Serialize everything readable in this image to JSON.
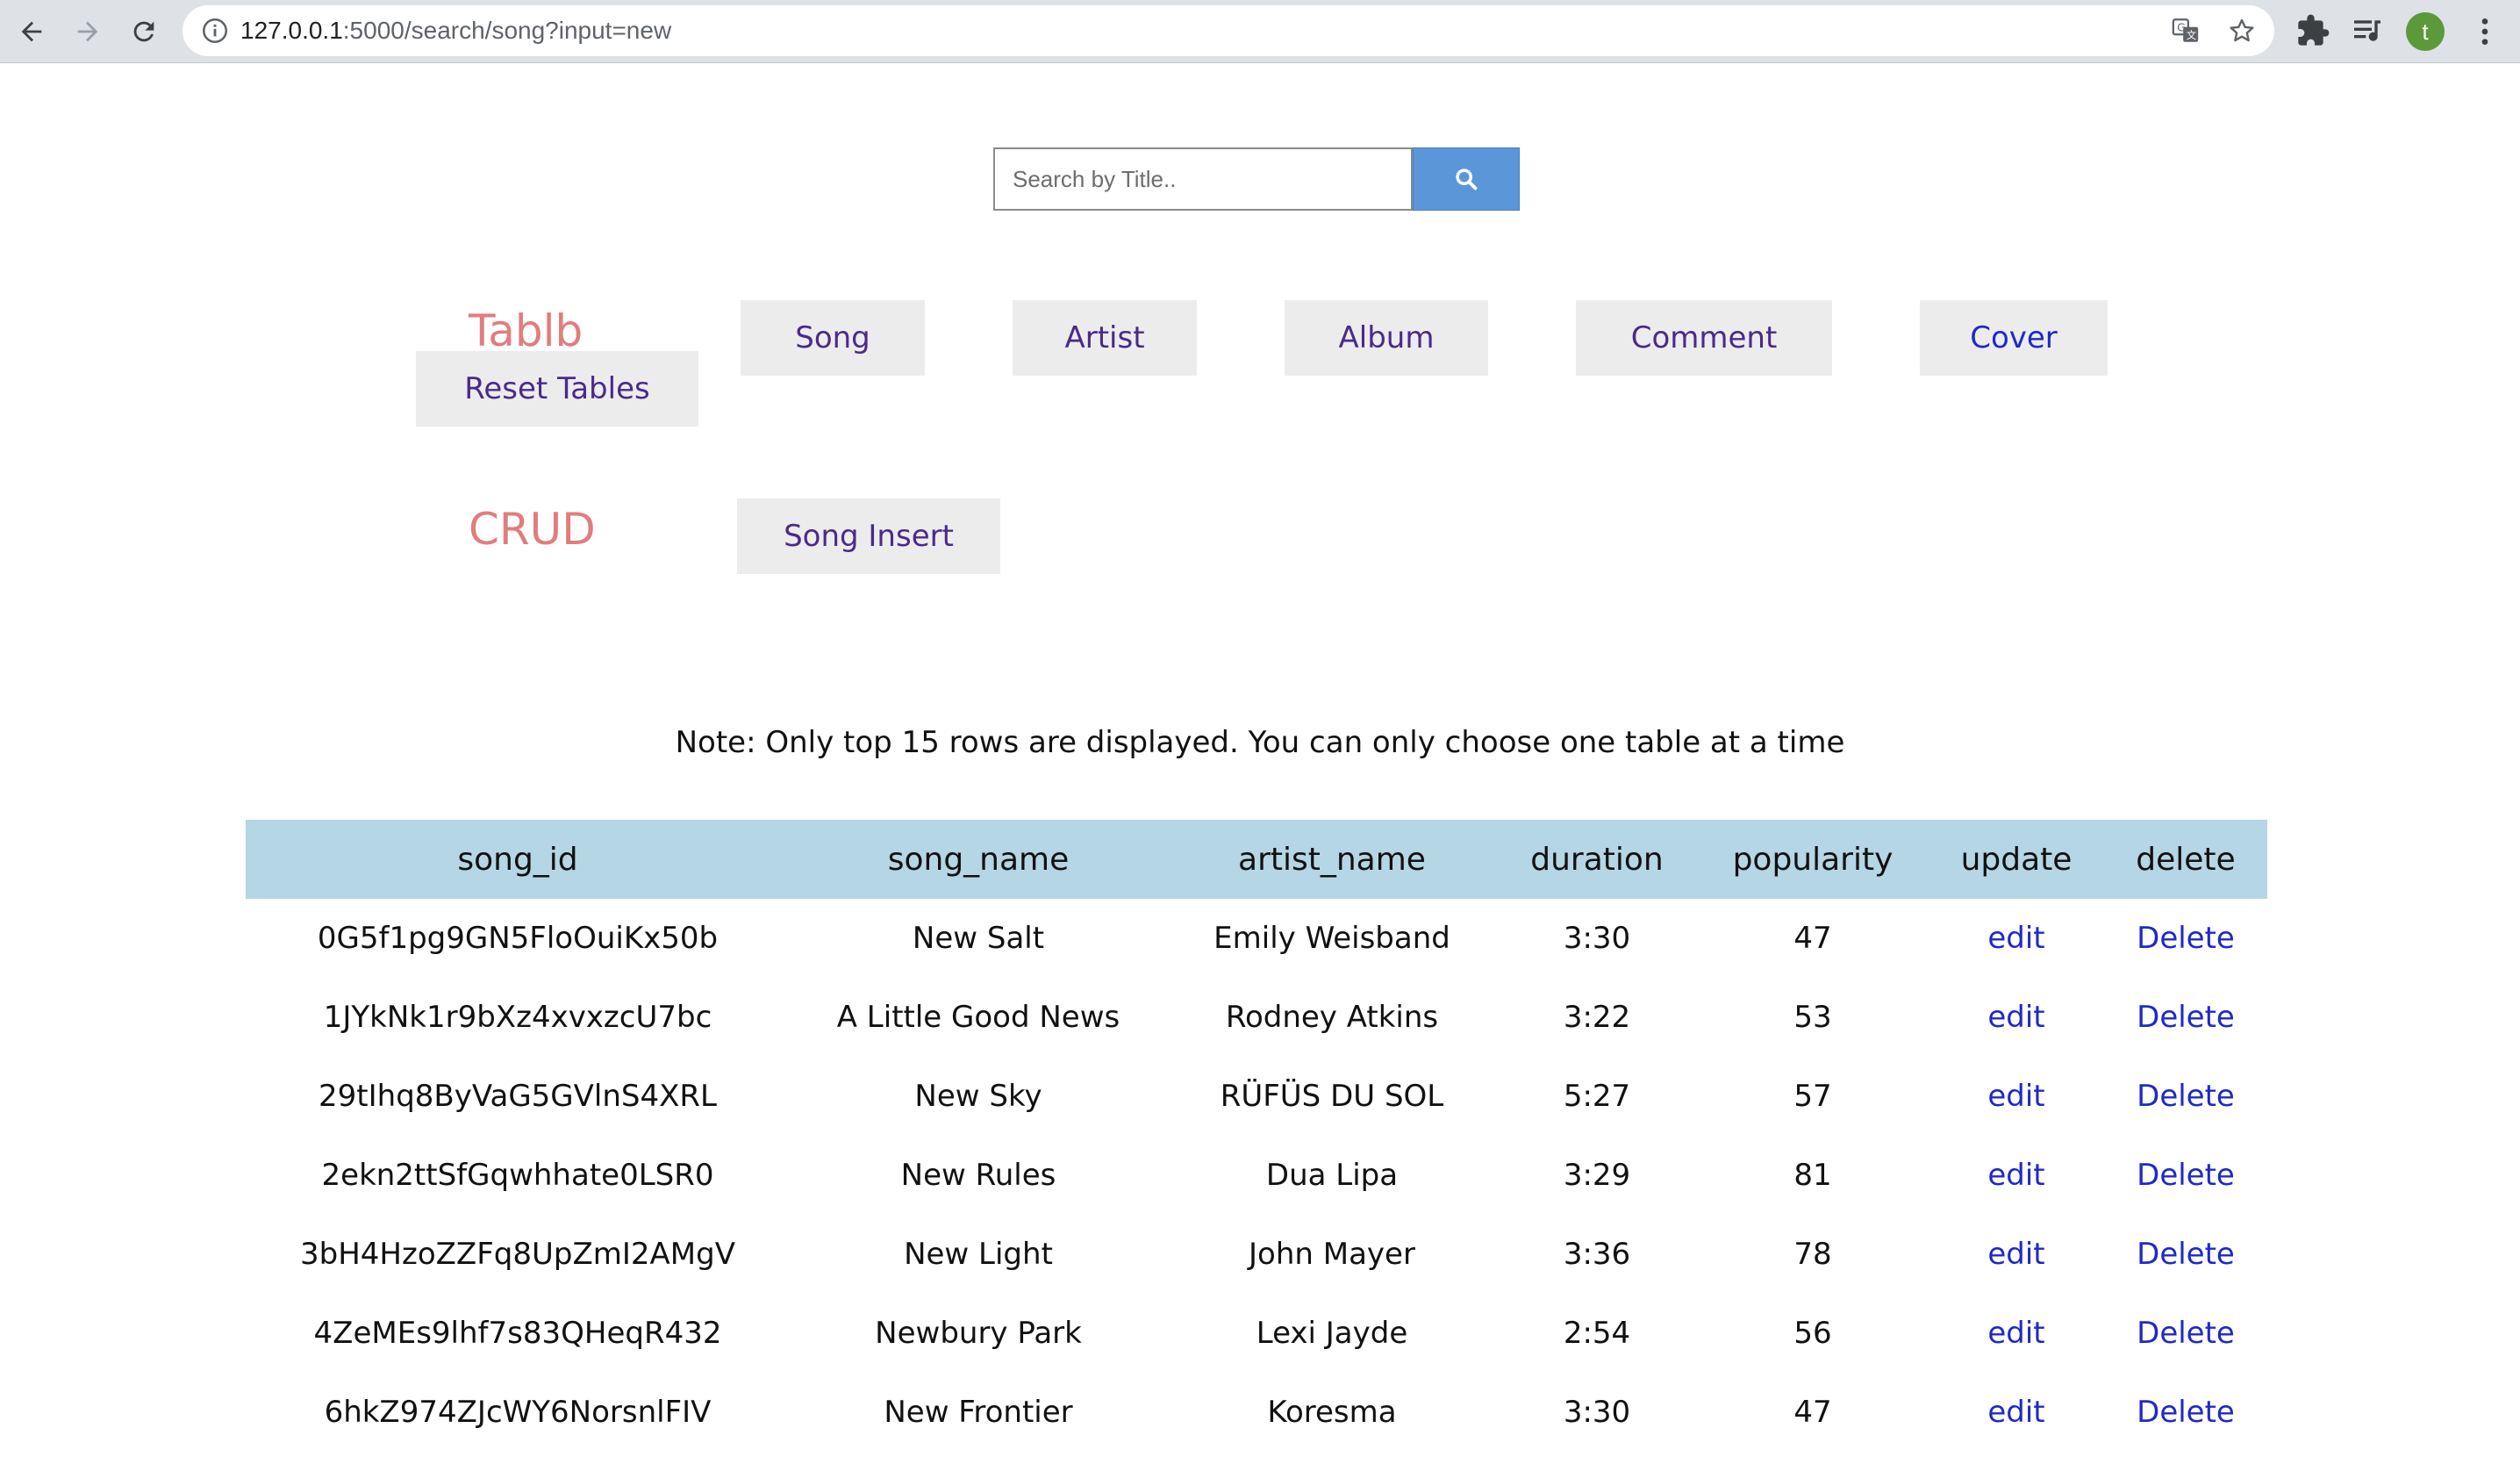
{
  "browser": {
    "url_host": "127.0.0.1",
    "url_path": ":5000/search/song?input=new",
    "profile_initial": "t"
  },
  "search": {
    "placeholder": "Search by Title..",
    "value": ""
  },
  "tables_section": {
    "title": "Tablb",
    "reset_label": "Reset Tables",
    "buttons": [
      "Song",
      "Artist",
      "Album",
      "Comment",
      "Cover"
    ]
  },
  "crud_section": {
    "title": "CRUD",
    "insert_label": "Song Insert"
  },
  "note": "Note: Only top 15 rows are displayed. You can only choose one table at a time",
  "table": {
    "columns": [
      "song_id",
      "song_name",
      "artist_name",
      "duration",
      "popularity",
      "update",
      "delete"
    ],
    "rows": [
      {
        "song_id": "0G5f1pg9GN5FloOuiKx50b",
        "song_name": "New Salt",
        "artist_name": "Emily Weisband",
        "duration": "3:30",
        "popularity": "47",
        "update": "edit",
        "delete": "Delete"
      },
      {
        "song_id": "1JYkNk1r9bXz4xvxzcU7bc",
        "song_name": "A Little Good News",
        "artist_name": "Rodney Atkins",
        "duration": "3:22",
        "popularity": "53",
        "update": "edit",
        "delete": "Delete"
      },
      {
        "song_id": "29tIhq8ByVaG5GVlnS4XRL",
        "song_name": "New Sky",
        "artist_name": "RÜFÜS DU SOL",
        "duration": "5:27",
        "popularity": "57",
        "update": "edit",
        "delete": "Delete"
      },
      {
        "song_id": "2ekn2ttSfGqwhhate0LSR0",
        "song_name": "New Rules",
        "artist_name": "Dua Lipa",
        "duration": "3:29",
        "popularity": "81",
        "update": "edit",
        "delete": "Delete"
      },
      {
        "song_id": "3bH4HzoZZFq8UpZmI2AMgV",
        "song_name": "New Light",
        "artist_name": "John Mayer",
        "duration": "3:36",
        "popularity": "78",
        "update": "edit",
        "delete": "Delete"
      },
      {
        "song_id": "4ZeMEs9lhf7s83QHeqR432",
        "song_name": "Newbury Park",
        "artist_name": "Lexi Jayde",
        "duration": "2:54",
        "popularity": "56",
        "update": "edit",
        "delete": "Delete"
      },
      {
        "song_id": "6hkZ974ZJcWY6NorsnlFIV",
        "song_name": "New Frontier",
        "artist_name": "Koresma",
        "duration": "3:30",
        "popularity": "47",
        "update": "edit",
        "delete": "Delete"
      }
    ]
  },
  "icons": {
    "back": "arrow-left-icon",
    "forward": "arrow-right-icon",
    "reload": "reload-icon",
    "site_info": "info-icon",
    "translate": "translate-icon",
    "bookmark": "star-icon",
    "extensions": "puzzle-icon",
    "media": "media-queue-icon",
    "menu": "kebab-menu-icon",
    "search": "search-icon"
  },
  "colors": {
    "section_title": "#e27d7d",
    "pill_bg": "#ececec",
    "pill_text": "#4a2a8a",
    "link": "#1f29c8",
    "table_header_bg": "#b5d6e4",
    "search_button": "#5b96d9"
  }
}
